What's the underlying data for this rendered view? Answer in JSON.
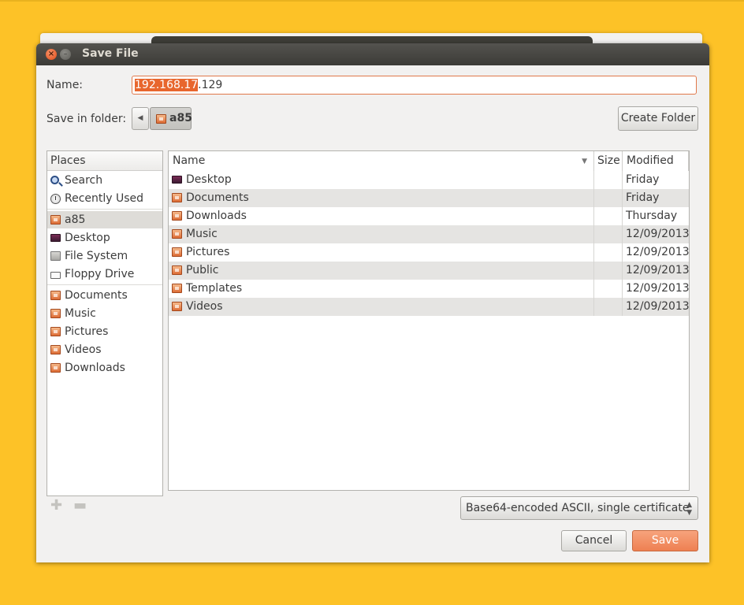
{
  "dialog": {
    "title": "Save File"
  },
  "name_field": {
    "label": "Name:",
    "value_selected": "192.168.17",
    "value_rest": ".129"
  },
  "folder": {
    "label": "Save in folder:",
    "current": "a85",
    "create_folder_label": "Create Folder"
  },
  "places": {
    "header": "Places",
    "items": [
      {
        "label": "Search",
        "icon": "search-icon"
      },
      {
        "label": "Recently Used",
        "icon": "recent-icon"
      },
      {
        "label": "a85",
        "icon": "home-folder-icon",
        "active": true
      },
      {
        "label": "Desktop",
        "icon": "desktop-icon"
      },
      {
        "label": "File System",
        "icon": "drive-icon"
      },
      {
        "label": "Floppy Drive",
        "icon": "floppy-icon"
      },
      {
        "label": "Documents",
        "icon": "folder-icon"
      },
      {
        "label": "Music",
        "icon": "folder-icon"
      },
      {
        "label": "Pictures",
        "icon": "folder-icon"
      },
      {
        "label": "Videos",
        "icon": "folder-icon"
      },
      {
        "label": "Downloads",
        "icon": "folder-icon"
      }
    ]
  },
  "file_list": {
    "columns": {
      "name": "Name",
      "size": "Size",
      "modified": "Modified"
    },
    "rows": [
      {
        "name": "Desktop",
        "size": "",
        "modified": "Friday"
      },
      {
        "name": "Documents",
        "size": "",
        "modified": "Friday"
      },
      {
        "name": "Downloads",
        "size": "",
        "modified": "Thursday"
      },
      {
        "name": "Music",
        "size": "",
        "modified": "12/09/2013"
      },
      {
        "name": "Pictures",
        "size": "",
        "modified": "12/09/2013"
      },
      {
        "name": "Public",
        "size": "",
        "modified": "12/09/2013"
      },
      {
        "name": "Templates",
        "size": "",
        "modified": "12/09/2013"
      },
      {
        "name": "Videos",
        "size": "",
        "modified": "12/09/2013"
      }
    ]
  },
  "filter": {
    "selected": "Base64-encoded ASCII, single certificate"
  },
  "buttons": {
    "cancel": "Cancel",
    "save": "Save"
  },
  "colors": {
    "accent": "#e8662d",
    "titlebar": "#3c3b37",
    "desktop_bg": "#fdc227"
  }
}
